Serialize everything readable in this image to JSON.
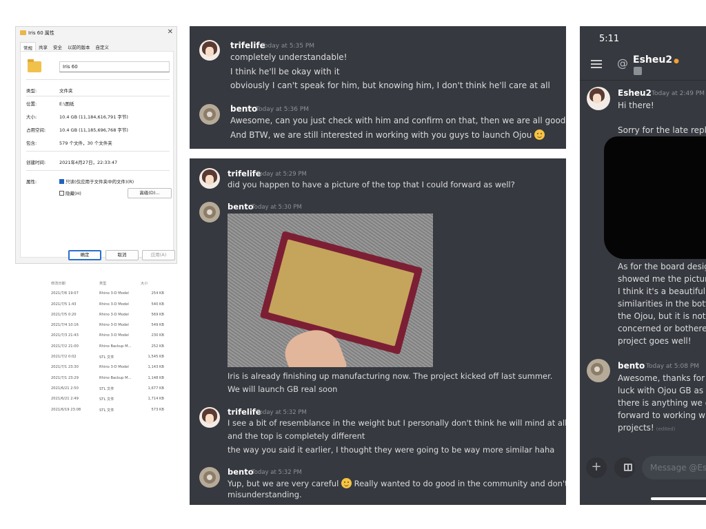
{
  "props_dialog": {
    "title": "Iris 60 属性",
    "close": "✕",
    "tabs": [
      "常规",
      "共享",
      "安全",
      "以前的版本",
      "自定义"
    ],
    "folder_name": "Iris 60",
    "rows": [
      {
        "label": "类型:",
        "value": "文件夹"
      },
      {
        "label": "位置:",
        "value": "E:\\图纸"
      },
      {
        "label": "大小:",
        "value": "10.4 GB (11,184,616,791 字节)"
      },
      {
        "label": "占用空间:",
        "value": "10.4 GB (11,185,696,768 字节)"
      },
      {
        "label": "包含:",
        "value": "579 个文件，30 个文件夹"
      },
      {
        "label": "创建时间:",
        "value": "2021年4月27日，22:33:47"
      },
      {
        "label": "属性:",
        "value": ""
      }
    ],
    "readonly_label": "只读(仅应用于文件夹中的文件)(R)",
    "hidden_label": "隐藏(H)",
    "advanced_button": "高级(D)...",
    "ok_button": "确定",
    "cancel_button": "取消",
    "apply_button": "应用(A)"
  },
  "file_list": {
    "headers": [
      "修改日期",
      "类型",
      "大小"
    ],
    "rows": [
      [
        "2021/7/6 19:07",
        "Rhino 3-D Model",
        "254 KB"
      ],
      [
        "2021/7/5 1:43",
        "Rhino 3-D Model",
        "540 KB"
      ],
      [
        "2021/7/5 0:20",
        "Rhino 3-D Model",
        "569 KB"
      ],
      [
        "2021/7/4 10:16",
        "Rhino 3-D Model",
        "549 KB"
      ],
      [
        "2021/7/3 21:43",
        "Rhino 3-D Model",
        "230 KB"
      ],
      [
        "2021/7/2 21:00",
        "Rhino Backup M...",
        "252 KB"
      ],
      [
        "2021/7/2 0:02",
        "STL 文件",
        "1,545 KB"
      ],
      [
        "2021/7/1 23:30",
        "Rhino 3-D Model",
        "1,143 KB"
      ],
      [
        "2021/7/1 23:29",
        "Rhino Backup M...",
        "1,148 KB"
      ],
      [
        "2021/6/21 2:50",
        "STL 文件",
        "1,677 KB"
      ],
      [
        "2021/6/21 2:49",
        "STL 文件",
        "1,714 KB"
      ],
      [
        "2021/6/19 23:08",
        "STL 文件",
        "573 KB"
      ]
    ]
  },
  "chat1": {
    "messages": [
      {
        "user": "trifelife",
        "time": "Today at 5:35 PM",
        "lines": [
          "completely understandable!",
          "I think he'll be okay with it",
          "obviously I can't speak for him, but knowing him, I don't think he'll care at all"
        ]
      },
      {
        "user": "bento",
        "time": "Today at 5:36 PM",
        "lines": [
          "Awesome, can you just check with him and confirm on that, then we are all good.",
          "And BTW, we are still interested in working with you guys to launch Ojou"
        ]
      }
    ]
  },
  "chat2": {
    "messages": [
      {
        "user": "trifelife",
        "time": "Today at 5:29 PM",
        "lines": [
          "did you happen to have a picture of the top that I could forward as well?"
        ]
      },
      {
        "user": "bento",
        "time": "Today at 5:30 PM",
        "lines": [
          "Iris is already finishing up manufacturing now. The project kicked off last summer.",
          "We will launch GB real soon"
        ]
      },
      {
        "user": "trifelife",
        "time": "Today at 5:32 PM",
        "lines": [
          "I see a bit of resemblance in the weight but I personally don't think he will mind at all",
          "and the top is completely different",
          "the way you said it earlier, I thought they were going to be way more similar haha"
        ]
      },
      {
        "user": "bento",
        "time": "Today at 5:32 PM",
        "lines": [
          "Yup, but we are very careful",
          "Really wanted to do good in the community and don't want any",
          "misunderstanding."
        ]
      }
    ]
  },
  "mobile": {
    "status_time": "5:11",
    "at_symbol": "@",
    "channel_name": "Esheu2",
    "messages": [
      {
        "user": "Esheu2",
        "time": "Today at 2:49 PM",
        "lines": [
          "Hi there!",
          "",
          "Sorry for the late replv"
        ]
      },
      {
        "user": "",
        "time": "",
        "lines": [
          "As for the board desigr",
          "showed me the picture",
          "I think it's a beautiful b",
          "similarities in the botto",
          "the Ojou, but it is nothi",
          "concerned or bothered",
          "project goes well!"
        ]
      },
      {
        "user": "bento",
        "time": "Today at 5:08 PM",
        "lines": [
          "Awesome, thanks for y",
          "luck with Ojou GB as w",
          "there is anything we ca",
          "forward to working wit",
          "projects!"
        ]
      }
    ],
    "edited_label": "(edited)",
    "input_placeholder": "Message @Esh",
    "plus_icon": "+"
  }
}
